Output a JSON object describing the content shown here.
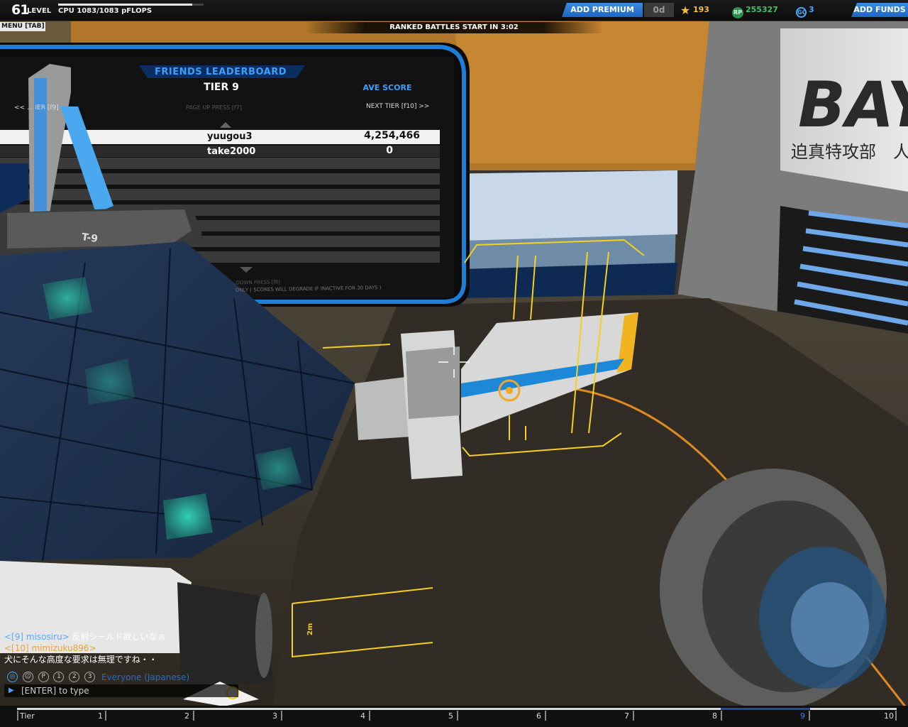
{
  "topbar": {
    "level": "61",
    "level_word": "LEVEL",
    "cpu": "CPU 1083/1083 pFLOPS",
    "add_premium": "ADD PREMIUM",
    "premium_days": "0d",
    "tech_points": "193",
    "robits": "255327",
    "galaxy_coins": "3",
    "add_funds": "ADD FUNDS",
    "menu": "MENU [TAB]",
    "ranked_banner": "RANKED BATTLES START IN 3:02"
  },
  "leaderboard": {
    "title": "FRIENDS LEADERBOARD",
    "tier": "TIER 9",
    "ave_score_header": "AVE SCORE",
    "prev_tier": "<< ... IER [f9]",
    "page_up": "PAGE UP PRESS [f7]",
    "next_tier": "NEXT TIER [f10] >>",
    "rows": [
      {
        "name": "yuugou3",
        "score": "4,254,466"
      },
      {
        "name": "take2000",
        "score": "0"
      }
    ],
    "page_down": "...DOWN PRESS [f8]",
    "note": "ONLY ( SCORES WILL DEGRADE IF INACTIVE FOR 30 DAYS )"
  },
  "scene": {
    "cube_label": "T-9",
    "wing_label": "T-9",
    "bay_sign": "BAY",
    "bay_japanese": "迫真特攻部　人間",
    "floor_marking": "2m"
  },
  "chat": {
    "messages": [
      {
        "sender": "<[9] misosiru>",
        "text": "反射シールド欲しいなぁ",
        "sender_color": "blue"
      },
      {
        "sender": "<[10] mimizuku896>",
        "text": "",
        "sender_color": "orange"
      },
      {
        "sender": "",
        "text": "犬にそんな高度な要求は無理ですね・・",
        "sender_color": "none"
      }
    ],
    "channels": [
      "1",
      "2",
      "3"
    ],
    "channel_label": "Everyone (Japanese)",
    "input_placeholder": "[ENTER] to type"
  },
  "tierbar": {
    "first_label": "Tier",
    "labels": [
      "1",
      "2",
      "3",
      "4",
      "5",
      "6",
      "7",
      "8",
      "9",
      "10"
    ],
    "active": "9"
  },
  "colors": {
    "accent_blue": "#39a0ff",
    "highlight_yellow": "#f5d020",
    "robits_green": "#3fc46a",
    "tech_gold": "#f1c232"
  }
}
